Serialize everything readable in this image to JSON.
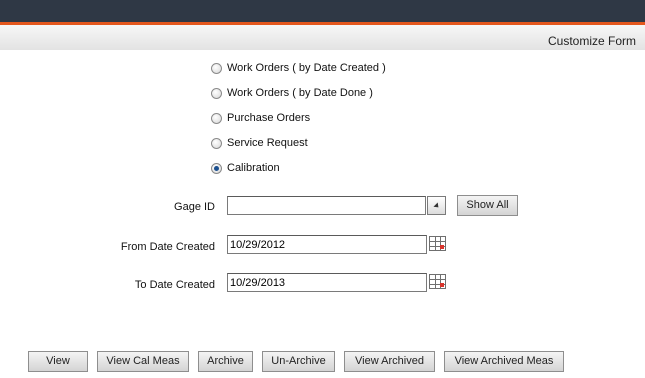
{
  "header": {
    "title": "Customize Form"
  },
  "report_types": [
    {
      "label": "Work Orders ( by Date Created )",
      "checked": false
    },
    {
      "label": "Work Orders ( by Date Done )",
      "checked": false
    },
    {
      "label": "Purchase Orders",
      "checked": false
    },
    {
      "label": "Service Request",
      "checked": false
    },
    {
      "label": "Calibration",
      "checked": true
    }
  ],
  "form": {
    "gage_id": {
      "label": "Gage ID",
      "value": "",
      "show_all_label": "Show All"
    },
    "from_date": {
      "label": "From Date Created",
      "value": "10/29/2012"
    },
    "to_date": {
      "label": "To Date Created",
      "value": "10/29/2013"
    }
  },
  "actions": {
    "view": "View",
    "view_cal_meas": "View Cal Meas",
    "archive": "Archive",
    "un_archive": "Un-Archive",
    "view_archived": "View Archived",
    "view_archived_meas": "View Archived Meas"
  },
  "colors": {
    "topbar": "#2f3845",
    "accent": "#e4571d",
    "selected_radio": "#1b4f8e"
  }
}
